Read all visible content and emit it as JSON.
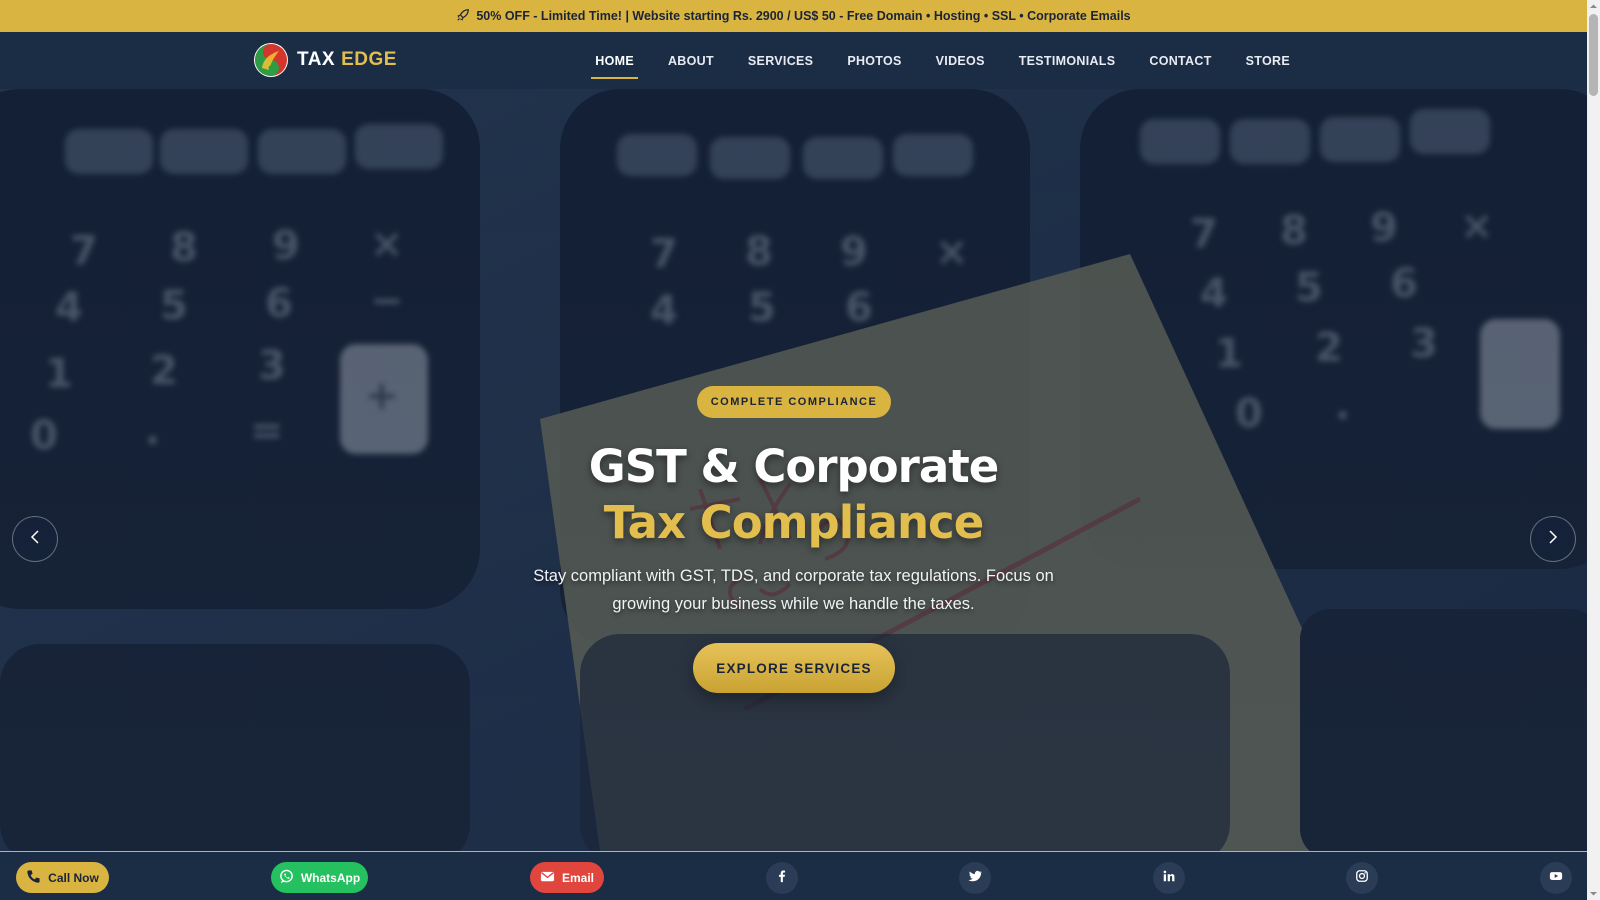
{
  "promo": {
    "icon": "rocket-icon",
    "text": "50% OFF - Limited Time! | Website starting Rs. 2900 / US$ 50 - Free Domain • Hosting • SSL • Corporate Emails"
  },
  "brand": {
    "name_part1": "TAX",
    "name_part2": "EDGE",
    "logo_icon": "yin-yang-logo-icon"
  },
  "nav": {
    "items": [
      {
        "label": "HOME",
        "active": true
      },
      {
        "label": "ABOUT"
      },
      {
        "label": "SERVICES"
      },
      {
        "label": "PHOTOS"
      },
      {
        "label": "VIDEOS"
      },
      {
        "label": "TESTIMONIALS"
      },
      {
        "label": "CONTACT"
      },
      {
        "label": "STORE"
      }
    ]
  },
  "hero": {
    "badge": "COMPLETE COMPLIANCE",
    "title_line1": "GST & Corporate",
    "title_line2": "Tax Compliance",
    "subtitle": "Stay compliant with GST, TDS, and corporate tax regulations. Focus on growing your business while we handle the taxes.",
    "cta_label": "EXPLORE SERVICES"
  },
  "bottom_bar": {
    "call_label": "Call Now",
    "whatsapp_label": "WhatsApp",
    "email_label": "Email",
    "socials": [
      "facebook-icon",
      "twitter-icon",
      "linkedin-icon",
      "instagram-icon",
      "youtube-icon"
    ]
  },
  "colors": {
    "accent": "#d9b441",
    "navy": "#1b2d45",
    "whatsapp": "#25c05f",
    "email": "#e0453e"
  }
}
